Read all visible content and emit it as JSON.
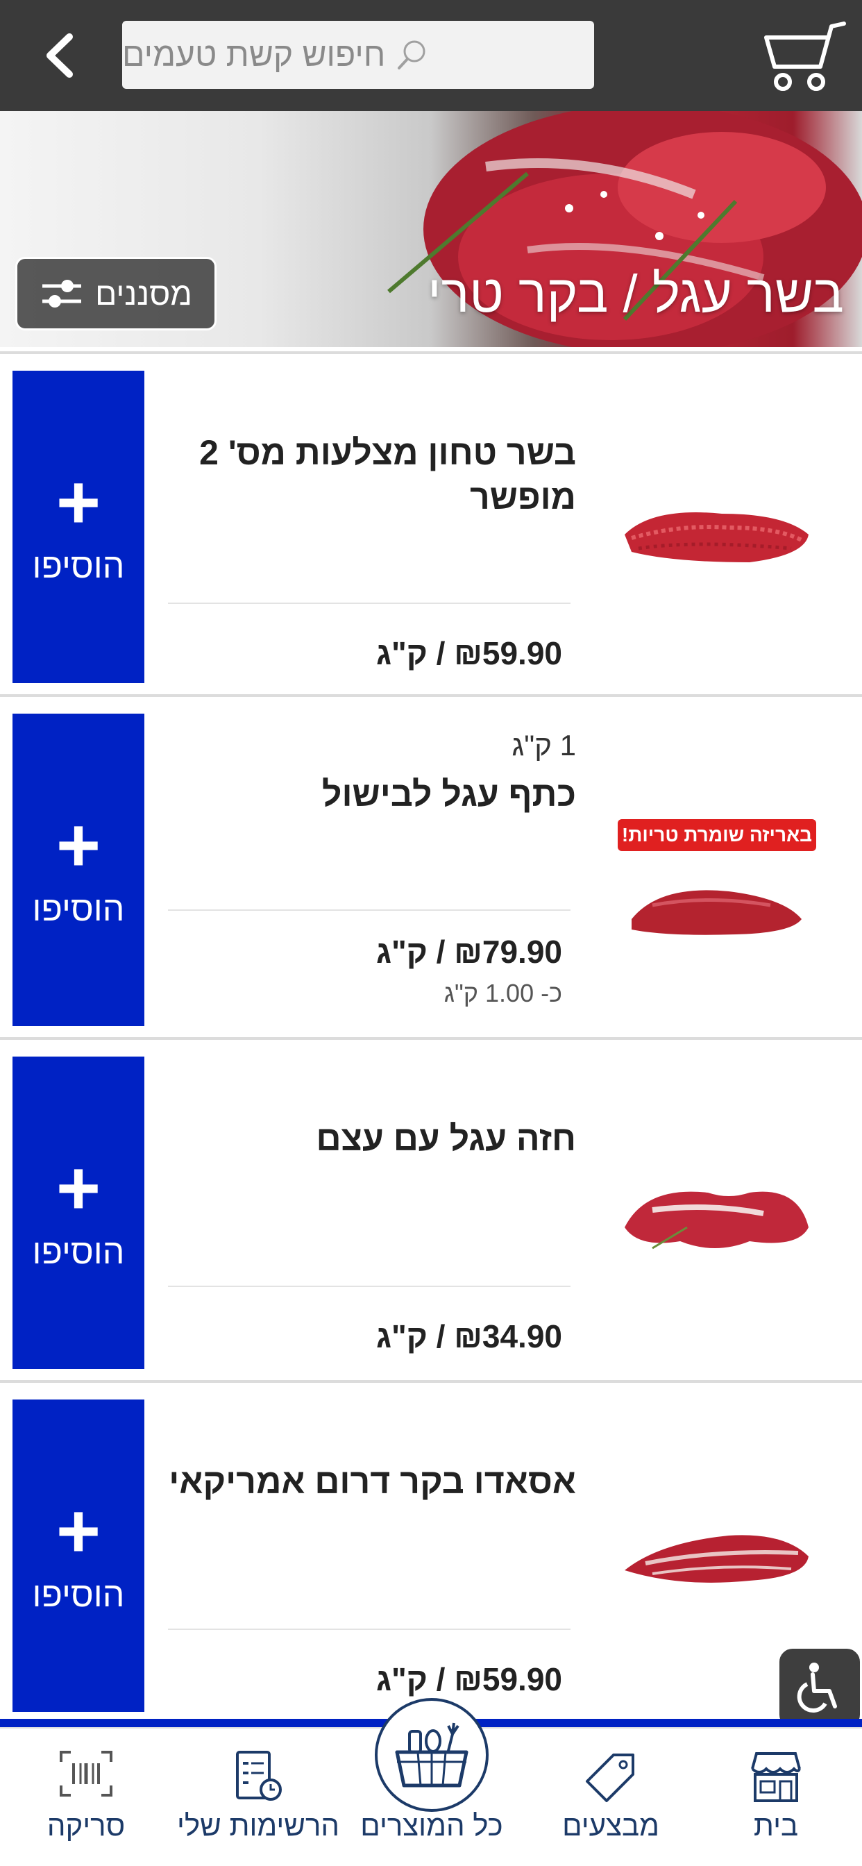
{
  "header": {
    "search_placeholder": "חיפוש קשת טעמים",
    "icons": {
      "back": "chevron-left-icon",
      "search": "search-icon",
      "cart": "cart-icon"
    }
  },
  "hero": {
    "title": "בשר עגל / בקר טרי",
    "filter_label": "מסננים"
  },
  "products": [
    {
      "name": "בשר טחון מצלעות מס' 2 מופשר",
      "weight": "",
      "price": "₪59.90 / ק\"ג",
      "approx": "",
      "badge": "",
      "add_label": "הוסיפו"
    },
    {
      "name": "כתף עגל לבישול",
      "weight": "1 ק\"ג",
      "price": "₪79.90 / ק\"ג",
      "approx": "כ- 1.00 ק\"ג",
      "badge": "באריזה שומרת טריות!",
      "add_label": "הוסיפו"
    },
    {
      "name": "חזה עגל עם עצם",
      "weight": "",
      "price": "₪34.90 / ק\"ג",
      "approx": "",
      "badge": "",
      "add_label": "הוסיפו"
    },
    {
      "name": "אסאדו בקר דרום אמריקאי",
      "weight": "",
      "price": "₪59.90 / ק\"ג",
      "approx": "",
      "badge": "",
      "add_label": "הוסיפו"
    }
  ],
  "bottom_nav": {
    "items": [
      {
        "label": "בית",
        "icon": "store-icon"
      },
      {
        "label": "מבצעים",
        "icon": "price-tag-icon"
      },
      {
        "label": "כל המוצרים",
        "icon": "grocery-basket-icon"
      },
      {
        "label": "הרשימות שלי",
        "icon": "checklist-icon"
      },
      {
        "label": "סריקה",
        "icon": "barcode-scan-icon"
      }
    ]
  },
  "accessibility": {
    "icon": "wheelchair-icon"
  },
  "colors": {
    "accent_blue": "#0022c4",
    "header_bg": "#3a3a3a",
    "nav_text": "#1c3a68",
    "promo_red": "#e02020"
  }
}
